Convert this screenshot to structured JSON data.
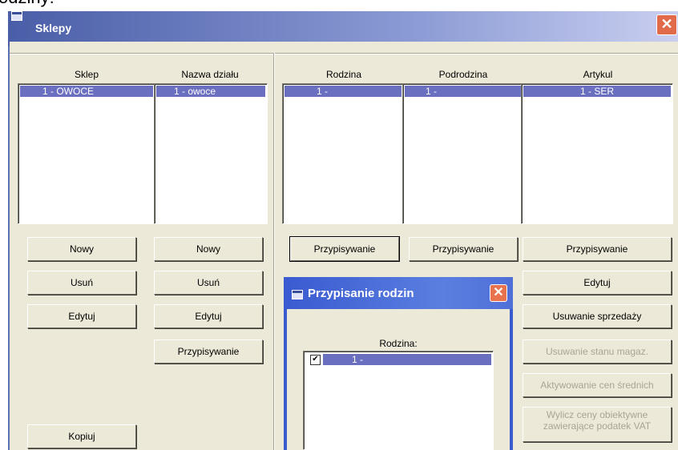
{
  "page_text": "odziny:",
  "window": {
    "title": "Sklepy",
    "close_glyph": "✕"
  },
  "left_panel": {
    "col1_header": "Sklep",
    "col2_header": "Nazwa działu",
    "col1_items": [
      "1 - OWOCE"
    ],
    "col2_items": [
      "1 - owoce"
    ],
    "col1_buttons": [
      "Nowy",
      "Usuń",
      "Edytuj",
      "Kopiuj"
    ],
    "col2_buttons": [
      "Nowy",
      "Usuń",
      "Edytuj",
      "Przypisywanie"
    ]
  },
  "right_panel": {
    "rodzina_header": "Rodzina",
    "podrodzina_header": "Podrodzina",
    "artykul_header": "Artykul",
    "rodzina_items": [
      "1 -"
    ],
    "podrodzina_items": [
      "1 -"
    ],
    "artykul_items": [
      "1 - SER"
    ],
    "rodzina_button": "Przypisywanie",
    "podrodzina_button": "Przypisywanie",
    "artykul_buttons": [
      {
        "label": "Przypisywanie",
        "enabled": true
      },
      {
        "label": "Edytuj",
        "enabled": true
      },
      {
        "label": "Usuwanie sprzedaży",
        "enabled": true
      },
      {
        "label": "Usuwanie stanu magaz.",
        "enabled": false
      },
      {
        "label": "Aktywowanie cen średnich",
        "enabled": false
      },
      {
        "label_line1": "Wylicz ceny obiektywne",
        "label_line2": "zawierające podatek VAT",
        "enabled": false
      }
    ]
  },
  "dialog": {
    "title": "Przypisanie rodzin",
    "close_glyph": "✕",
    "label": "Rodzina:",
    "items": [
      {
        "label": "1 -",
        "checked": true,
        "check_glyph": "✔"
      }
    ]
  },
  "icons": [
    "window-icon",
    "close-icon",
    "checkbox-icon"
  ],
  "colors": {
    "selection": "#6b6fc0",
    "title_bar": "#4a5ea8",
    "dialog_title": "#3a5ad0",
    "face": "#ece9d8"
  }
}
